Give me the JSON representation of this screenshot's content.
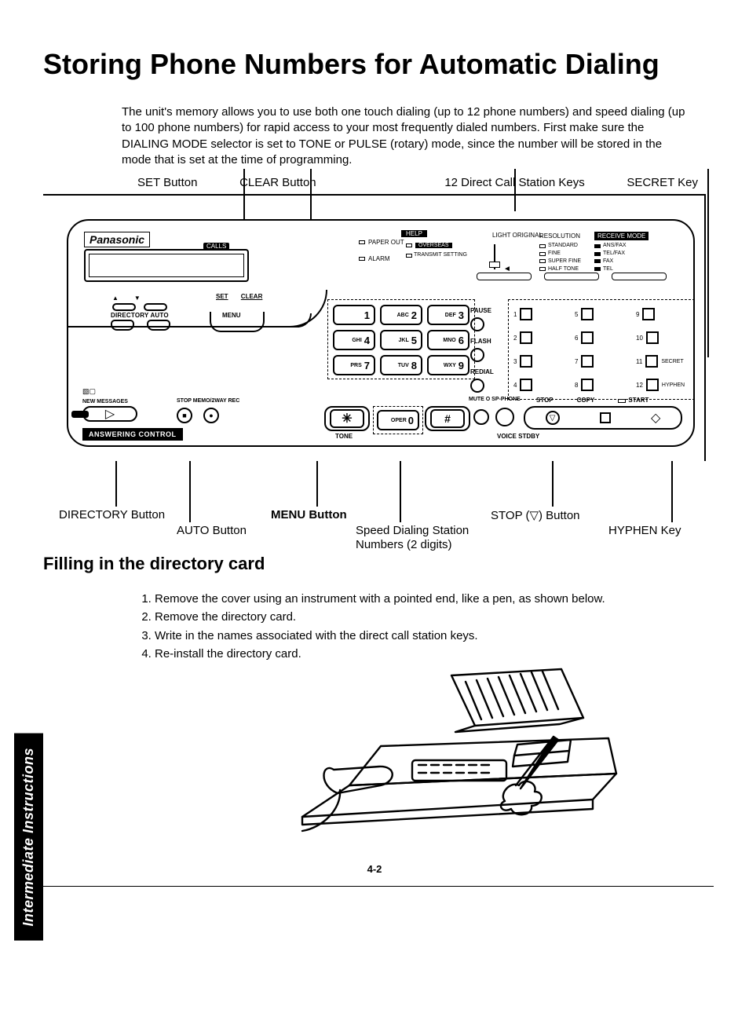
{
  "title": "Storing Phone Numbers for Automatic Dialing",
  "intro": "The unit's memory allows you to use both one touch dialing (up to 12 phone numbers) and speed dialing (up to 100 phone numbers) for rapid access to your most frequently dialed numbers. First make sure the DIALING MODE selector is set to TONE or PULSE (rotary) mode, since the number will be stored in the mode that is set at the time of programming.",
  "callouts_top": {
    "set": "SET Button",
    "clear": "CLEAR Button",
    "stations": "12 Direct Call Station Keys",
    "secret": "SECRET Key"
  },
  "callouts_bot": {
    "directory": "DIRECTORY Button",
    "auto": "AUTO Button",
    "menu": "MENU Button",
    "speed": "Speed Dialing Station Numbers (2 digits)",
    "stop": "STOP (▽) Button",
    "hyphen": "HYPHEN Key"
  },
  "panel": {
    "brand": "Panasonic",
    "calls": "CALLS",
    "help": "HELP",
    "overseas": "OVERSEAS",
    "mid": {
      "paper_out": "PAPER OUT",
      "transmit": "TRANSMIT SETTING",
      "alarm": "ALARM"
    },
    "light_original": "LIGHT ORIGINAL",
    "resolution": {
      "title": "RESOLUTION",
      "r1": "STANDARD",
      "r2": "FINE",
      "r3": "SUPER FINE",
      "r4": "HALF TONE"
    },
    "receive": {
      "title": "RECEIVE MODE",
      "r1": "ANS/FAX",
      "r2": "TEL/FAX",
      "r3": "FAX",
      "r4": "TEL"
    },
    "ctrl": {
      "set": "SET",
      "clear": "CLEAR",
      "directory_auto": "DIRECTORY AUTO",
      "menu": "MENU"
    },
    "keys": {
      "k1": "1",
      "k2": "2",
      "k2p": "ABC",
      "k3": "3",
      "k3p": "DEF",
      "k4": "4",
      "k4p": "GHI",
      "k5": "5",
      "k5p": "JKL",
      "k6": "6",
      "k6p": "MNO",
      "k7": "7",
      "k7p": "PRS",
      "k8": "8",
      "k8p": "TUV",
      "k9": "9",
      "k9p": "WXY",
      "k0": "0",
      "k0p": "OPER",
      "star": "✳",
      "pound": "#"
    },
    "tone": "TONE",
    "pfr": {
      "pause": "PAUSE",
      "flash": "FLASH",
      "redial": "REDIAL"
    },
    "mute": "MUTE  O SP-PHONE",
    "voice": "VOICE STDBY",
    "bottom_labels": {
      "stop": "STOP",
      "copy": "COPY",
      "start": "START"
    },
    "ans": {
      "new_messages": "NEW MESSAGES",
      "stop_memo": "STOP   MEMO/2WAY REC",
      "badge": "ANSWERING CONTROL"
    },
    "stations": {
      "s1": "1",
      "s2": "2",
      "s3": "3",
      "s4": "4",
      "s5": "5",
      "s6": "6",
      "s7": "7",
      "s8": "8",
      "s9": "9",
      "s10": "10",
      "s11": "11",
      "s11t": "SECRET",
      "s12": "12",
      "s12t": "HYPHEN"
    }
  },
  "subheading": "Filling in the directory card",
  "steps": [
    "Remove the cover using an instrument with a pointed end, like a pen, as shown below.",
    "Remove the directory card.",
    "Write in the names associated with the direct call station keys.",
    "Re-install the directory card."
  ],
  "side_tab": "Intermediate Instructions",
  "page_number": "4-2"
}
